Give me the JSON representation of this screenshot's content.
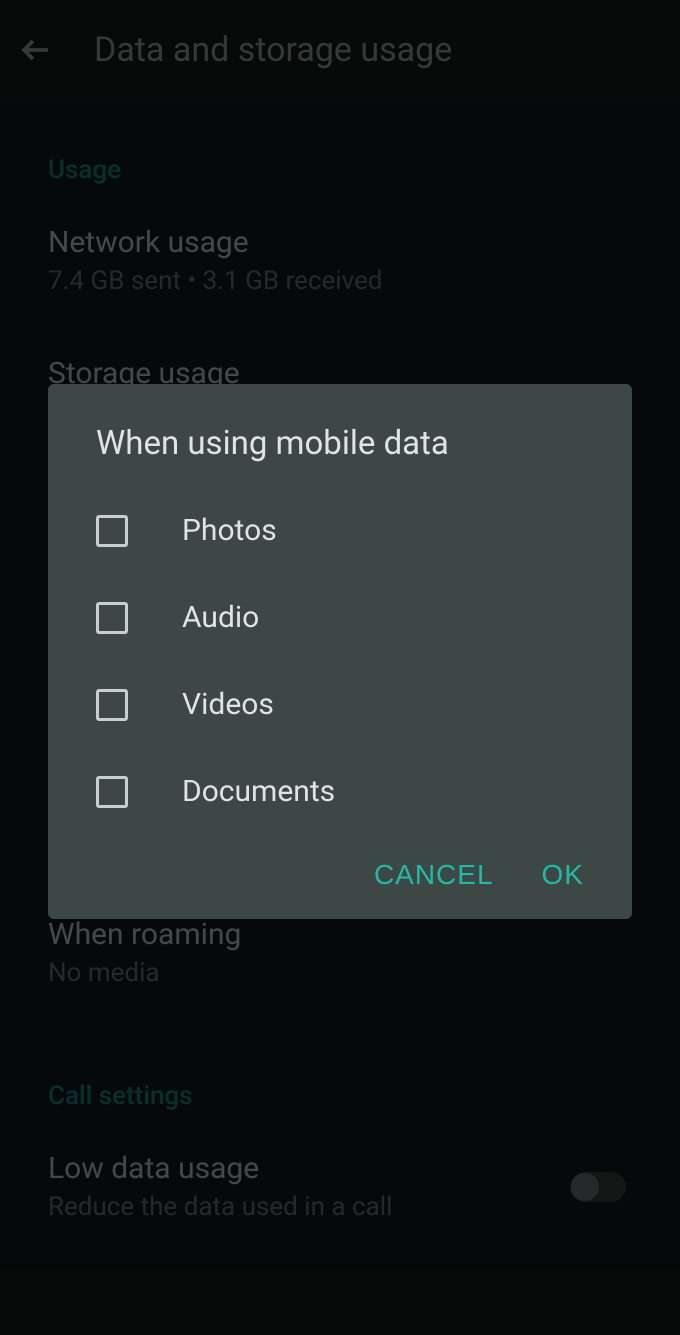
{
  "header": {
    "title": "Data and storage usage"
  },
  "sections": {
    "usage": {
      "header": "Usage",
      "network": {
        "title": "Network usage",
        "subtitle": "7.4 GB sent • 3.1 GB received"
      },
      "storage": {
        "title": "Storage usage"
      }
    },
    "roaming": {
      "title": "When roaming",
      "subtitle": "No media"
    },
    "callSettings": {
      "header": "Call settings",
      "lowData": {
        "title": "Low data usage",
        "subtitle": "Reduce the data used in a call"
      }
    }
  },
  "dialog": {
    "title": "When using mobile data",
    "options": [
      {
        "label": "Photos"
      },
      {
        "label": "Audio"
      },
      {
        "label": "Videos"
      },
      {
        "label": "Documents"
      }
    ],
    "cancelLabel": "CANCEL",
    "okLabel": "OK"
  }
}
